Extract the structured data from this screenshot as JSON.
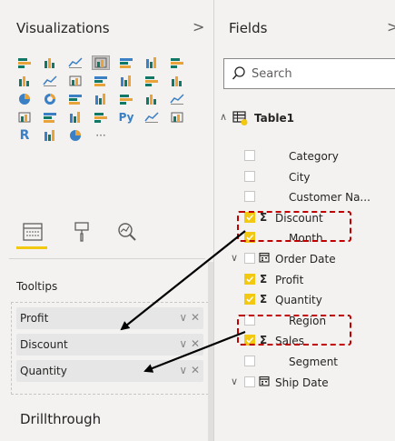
{
  "visualizations": {
    "title": "Visualizations",
    "expand_label": ">",
    "icons": [
      "stacked-bar-icon",
      "stacked-column-icon",
      "clustered-bar-icon",
      "clustered-column-icon",
      "100-stacked-bar-icon",
      "100-stacked-column-icon",
      "line-chart-icon",
      "area-chart-icon",
      "stacked-area-icon",
      "line-column-icon",
      "line-clustered-column-icon",
      "ribbon-chart-icon",
      "waterfall-icon",
      "scatter-icon",
      "pie-icon",
      "donut-icon",
      "treemap-icon",
      "map-icon",
      "filled-map-icon",
      "funnel-icon",
      "gauge-icon",
      "card-icon",
      "multi-row-card-icon",
      "kpi-icon",
      "slicer-icon",
      "python-visual-icon",
      "table-icon",
      "matrix-icon",
      "r-visual-icon",
      "arcgis-icon",
      "globe-icon",
      "more-icon"
    ],
    "python_label": "Py",
    "r_label": "R",
    "more_label": "···",
    "tabs": [
      "fields-tab-icon",
      "format-paint-icon",
      "analytics-icon"
    ],
    "tooltips_label": "Tooltips",
    "tooltip_fields": [
      {
        "label": "Profit"
      },
      {
        "label": "Discount"
      },
      {
        "label": "Quantity"
      }
    ],
    "chip_controls": "∨ ✕",
    "drillthrough_label": "Drillthrough"
  },
  "fields": {
    "title": "Fields",
    "expand_label": ">",
    "search_placeholder": "Search",
    "table_name": "Table1",
    "sigma": "Σ",
    "collapse_glyph": "∧",
    "expand_glyph": "∨",
    "items": [
      {
        "label": "Category",
        "checked": false,
        "sigma": false
      },
      {
        "label": "City",
        "checked": false,
        "sigma": false
      },
      {
        "label": "Customer Na...",
        "checked": false,
        "sigma": false
      },
      {
        "label": "Discount",
        "checked": true,
        "sigma": true,
        "highlight": true
      },
      {
        "label": "Month",
        "checked": true,
        "sigma": false
      },
      {
        "label": "Order Date",
        "checked": false,
        "sigma": false,
        "date": true
      },
      {
        "label": "Profit",
        "checked": true,
        "sigma": true
      },
      {
        "label": "Quantity",
        "checked": true,
        "sigma": true,
        "highlight": true
      },
      {
        "label": "Region",
        "checked": false,
        "sigma": false
      },
      {
        "label": "Sales",
        "checked": true,
        "sigma": true
      },
      {
        "label": "Segment",
        "checked": false,
        "sigma": false
      },
      {
        "label": "Ship Date",
        "checked": false,
        "sigma": false,
        "date": true
      }
    ]
  },
  "colors": {
    "accent": "#f2c811",
    "highlight": "#c00000",
    "arrow": "#000000",
    "panel_bg": "#f3f2f1"
  }
}
